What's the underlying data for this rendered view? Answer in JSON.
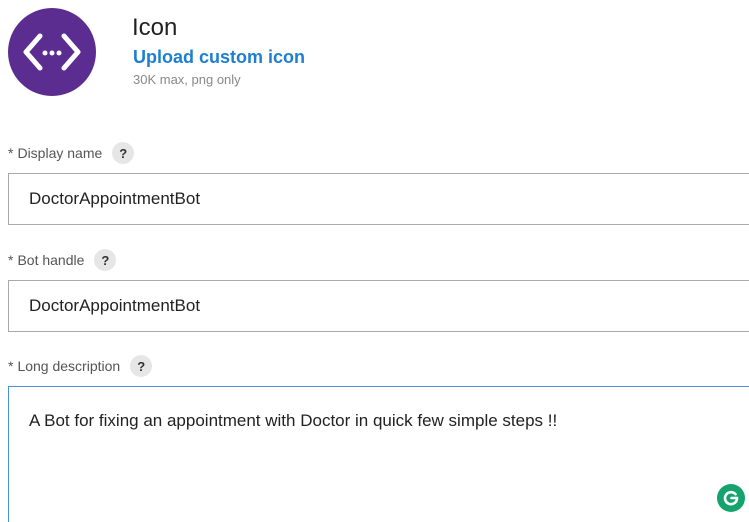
{
  "icon_section": {
    "title": "Icon",
    "upload_link": "Upload custom icon",
    "hint": "30K max, png only"
  },
  "fields": {
    "display_name": {
      "required_mark": "*",
      "label": "Display name",
      "help": "?",
      "value": "DoctorAppointmentBot"
    },
    "bot_handle": {
      "required_mark": "*",
      "label": "Bot handle",
      "help": "?",
      "value": "DoctorAppointmentBot"
    },
    "long_description": {
      "required_mark": "*",
      "label": "Long description",
      "help": "?",
      "value": "A Bot for fixing an appointment with Doctor in quick few simple steps !!"
    }
  },
  "colors": {
    "avatar_bg": "#5c2d91",
    "link": "#1e7fd0",
    "focus_border": "#4a90d9",
    "grammarly": "#15a36d"
  },
  "icons": [
    "bot-code-icon",
    "help-icon",
    "grammarly-icon"
  ]
}
